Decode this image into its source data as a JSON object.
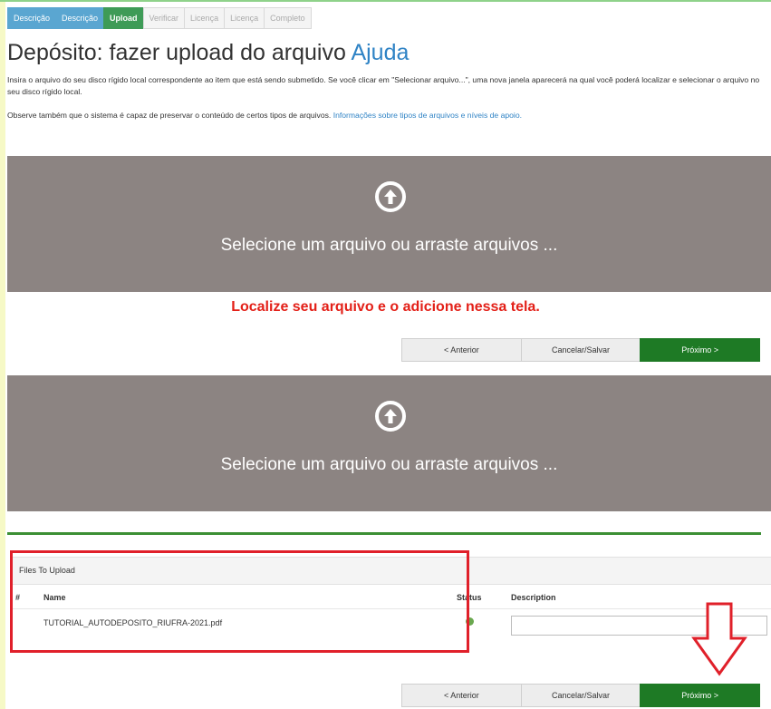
{
  "tabs": [
    {
      "label": "Descrição",
      "state": "done"
    },
    {
      "label": "Descrição",
      "state": "done"
    },
    {
      "label": "Upload",
      "state": "active"
    },
    {
      "label": "Verificar",
      "state": "pending"
    },
    {
      "label": "Licença",
      "state": "pending"
    },
    {
      "label": "Licença",
      "state": "pending"
    },
    {
      "label": "Completo",
      "state": "pending"
    }
  ],
  "page": {
    "title": "Depósito: fazer upload do arquivo",
    "help_link": "Ajuda",
    "intro": "Insira o arquivo do seu disco rígido local correspondente ao item que está sendo submetido. Se você clicar em \"Selecionar arquivo...\", uma nova janela aparecerá na qual você poderá localizar e selecionar o arquivo no seu disco rígido local.",
    "note_text": "Observe também que o sistema é capaz de preservar o conteúdo de certos tipos de arquivos.",
    "note_link": "Informações sobre tipos de arquivos e níveis de apoio."
  },
  "dropzone": {
    "text": "Selecione um arquivo ou arraste arquivos ...",
    "icon": "upload-circle-icon"
  },
  "instruction": "Localize seu arquivo e o adicione nessa tela.",
  "buttons": {
    "previous": "< Anterior",
    "cancel_save": "Cancelar/Salvar",
    "next": "Próximo >"
  },
  "files": {
    "panel_title": "Files To Upload",
    "columns": {
      "index": "#",
      "name": "Name",
      "status": "Status",
      "description": "Description"
    },
    "rows": [
      {
        "name": "TUTORIAL_AUTODEPOSITO_RIUFRA-2021.pdf",
        "status": "ok",
        "description": ""
      }
    ]
  },
  "colors": {
    "accent_done": "#5aa6d1",
    "accent_active": "#3e9b57",
    "primary_button": "#1e7a25",
    "highlight_red": "#e0202a",
    "dropzone_bg": "#8c8482"
  }
}
